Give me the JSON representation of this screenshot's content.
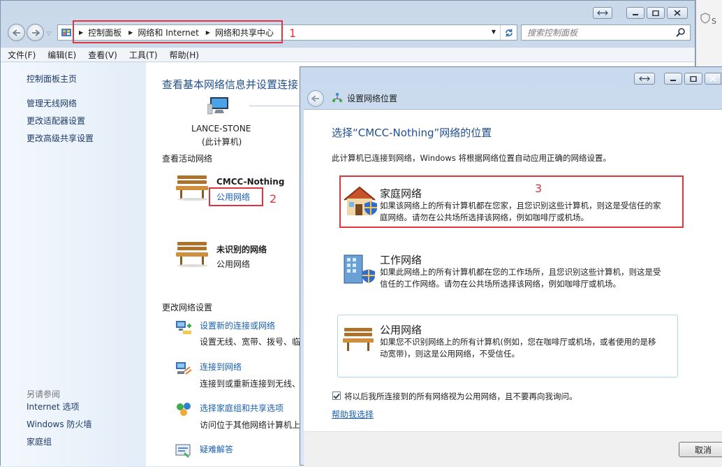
{
  "main_window": {
    "breadcrumb": [
      "控制面板",
      "网络和 Internet",
      "网络和共享中心"
    ],
    "search_placeholder": "搜索控制面板",
    "menu": [
      "文件(F)",
      "编辑(E)",
      "查看(V)",
      "工具(T)",
      "帮助(H)"
    ]
  },
  "left_pane": {
    "links": [
      "控制面板主页",
      "管理无线网络",
      "更改适配器设置",
      "更改高级共享设置"
    ],
    "see_also_title": "另请参阅",
    "see_also": [
      "Internet 选项",
      "Windows 防火墙",
      "家庭组"
    ]
  },
  "content": {
    "heading": "查看基本网络信息并设置连接",
    "computer_name": "LANCE-STONE",
    "computer_sub": "(此计算机)",
    "active_section": "查看活动网络",
    "network1_name": "CMCC-Nothing",
    "network1_type": "公用网络",
    "network2_name": "未识别的网络",
    "network2_type": "公用网络",
    "change_section": "更改网络设置",
    "tasks": [
      {
        "title": "设置新的连接或网络",
        "desc": "设置无线、宽带、拨号、临"
      },
      {
        "title": "连接到网络",
        "desc": "连接到或重新连接到无线、"
      },
      {
        "title": "选择家庭组和共享选项",
        "desc": "访问位于其他网络计算机上"
      },
      {
        "title": "疑难解答",
        "desc": ""
      }
    ]
  },
  "annotations": [
    "1",
    "2",
    "3"
  ],
  "dialog": {
    "title": "设置网络位置",
    "heading": "选择“CMCC-Nothing”网络的位置",
    "intro": "此计算机已连接到网络，Windows 将根据网络位置自动应用正确的网络设置。",
    "options": [
      {
        "title": "家庭网络",
        "line1": "如果该网络上的所有计算机都在您家，且您识别这些计算机，则这是受信任的家",
        "line2": "庭网络。请勿在公共场所选择该网络，例如咖啡厅或机场。"
      },
      {
        "title": "工作网络",
        "line1": "如果此网络上的所有计算机都在您的工作场所，且您识别这些计算机，则这是受",
        "line2": "信任的工作网络。请勿在公共场所选择该网络，例如咖啡厅或机场。"
      },
      {
        "title": "公用网络",
        "line1": "如果您不识别网络上的所有计算机(例如，您在咖啡厅或机场，或者使用的是移",
        "line2": "动宽带)，则这是公用网络，不受信任。"
      }
    ],
    "checkbox_label": "将以后我所连接到的所有网络视为公用网络，且不要再向我询问。",
    "checkbox_checked": true,
    "help_link": "帮助我选择",
    "cancel_label": "取消"
  },
  "colors": {
    "link": "#1a5fb4",
    "heading": "#1f4f8f",
    "annotation": "#e0343f"
  }
}
